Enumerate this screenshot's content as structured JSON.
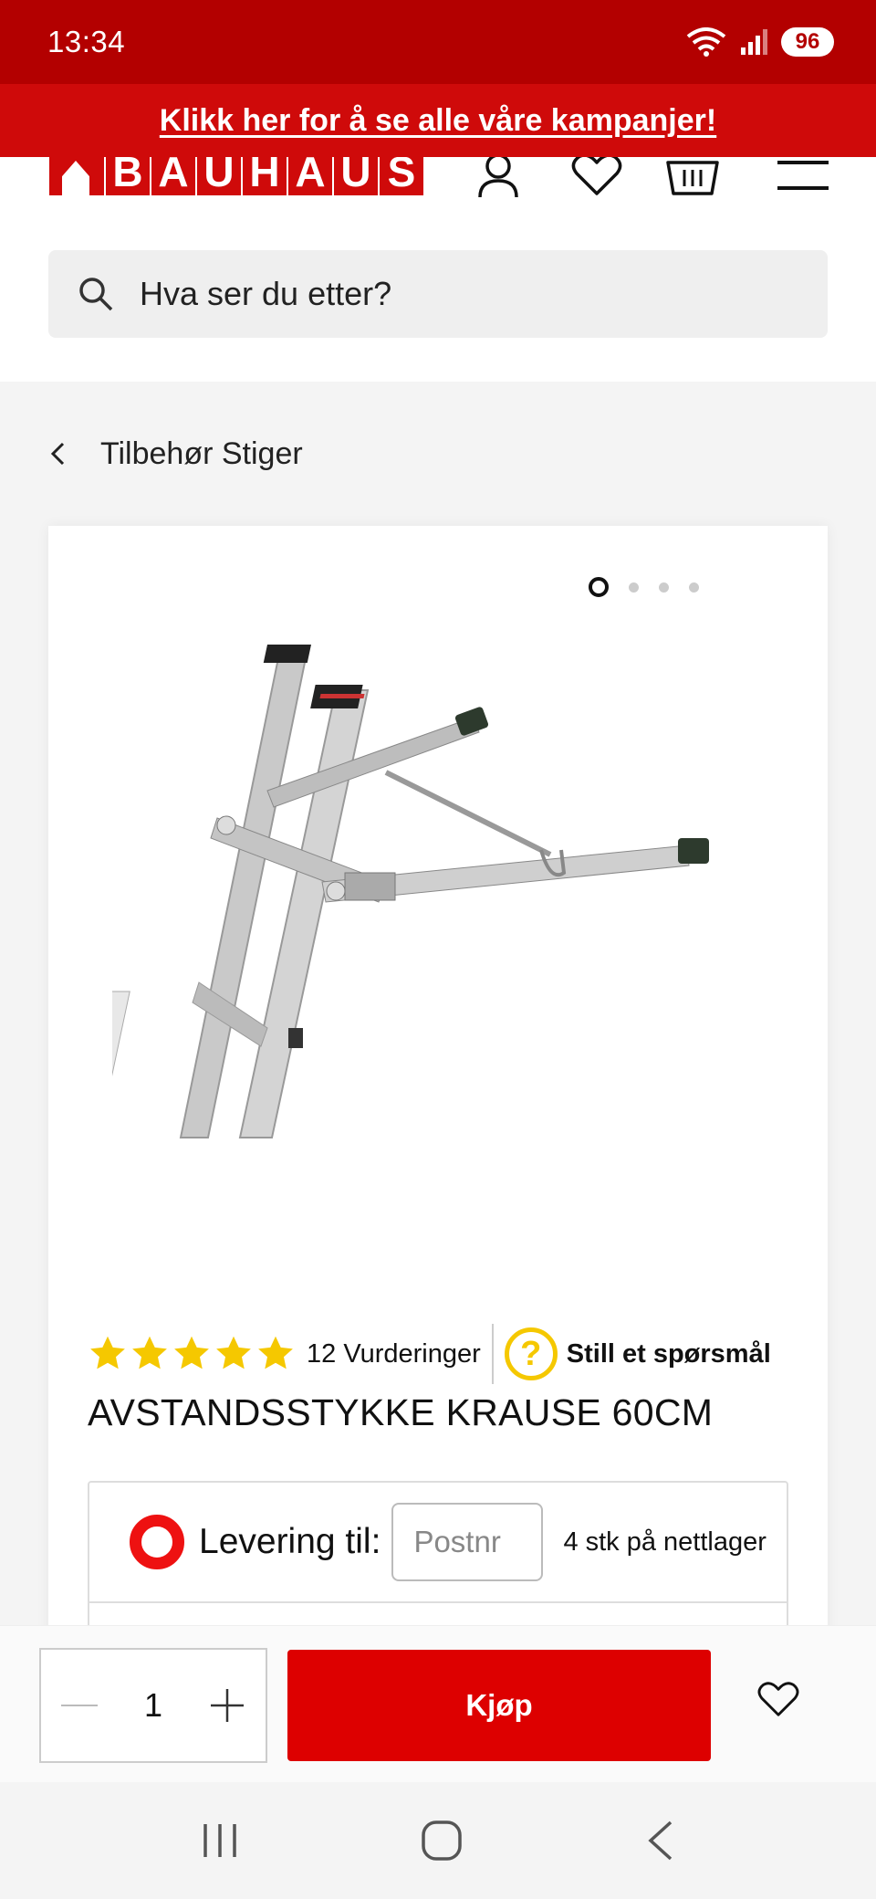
{
  "status_bar": {
    "time": "13:34",
    "battery": "96"
  },
  "promo": {
    "text": "Klikk her for å se alle våre kampanjer!"
  },
  "header": {
    "logo_letters": [
      "B",
      "A",
      "U",
      "H",
      "A",
      "U",
      "S"
    ],
    "icons": [
      "user-icon",
      "heart-icon",
      "basket-icon",
      "menu-icon"
    ]
  },
  "search": {
    "placeholder": "Hva ser du etter?"
  },
  "breadcrumb": {
    "label": "Tilbehør Stiger"
  },
  "gallery": {
    "image_count": 4,
    "active_index": 0
  },
  "product": {
    "rating_stars": 5,
    "reviews": "12 Vurderinger",
    "ask_label": "Still et spørsmål",
    "title": "AVSTANDSSTYKKE KRAUSE 60CM"
  },
  "delivery": {
    "label": "Levering til:",
    "postnr_placeholder": "Postnr",
    "stock_text": "4 stk på nettlager"
  },
  "buy_bar": {
    "quantity": "1",
    "buy_label": "Kjøp"
  },
  "colors": {
    "brand_red": "#d00000",
    "status_red": "#b30000",
    "star_yellow": "#f5c800"
  }
}
